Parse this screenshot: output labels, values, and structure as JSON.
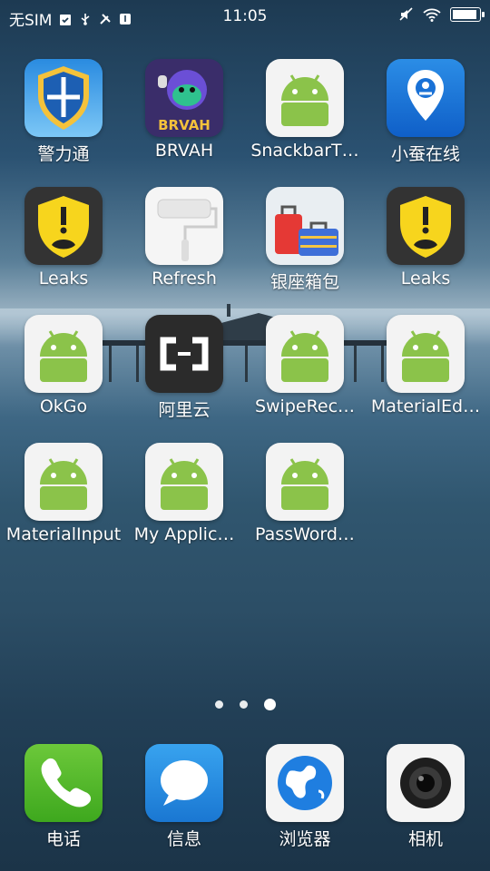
{
  "status": {
    "carrier": "无SIM",
    "time": "11:05"
  },
  "pages": {
    "count": 3,
    "current": 3
  },
  "apps": [
    {
      "label": "警力通",
      "icon": "shield-plane-icon"
    },
    {
      "label": "BRVAH",
      "icon": "gorilla-icon"
    },
    {
      "label": "SnackbarT…",
      "icon": "android-icon"
    },
    {
      "label": "小蚕在线",
      "icon": "pin-robot-icon"
    },
    {
      "label": "Leaks",
      "icon": "leak-shield-icon"
    },
    {
      "label": "Refresh",
      "icon": "paint-roller-icon"
    },
    {
      "label": "银座箱包",
      "icon": "luggage-icon"
    },
    {
      "label": "Leaks",
      "icon": "leak-shield-icon"
    },
    {
      "label": "OkGo",
      "icon": "android-icon"
    },
    {
      "label": "阿里云",
      "icon": "aliyun-icon"
    },
    {
      "label": "SwipeRec…",
      "icon": "android-icon"
    },
    {
      "label": "MaterialEd…",
      "icon": "android-icon"
    },
    {
      "label": "MaterialInput",
      "icon": "android-icon"
    },
    {
      "label": "My Applic…",
      "icon": "android-icon"
    },
    {
      "label": "PassWord…",
      "icon": "android-icon"
    }
  ],
  "dock": [
    {
      "label": "电话",
      "icon": "phone-icon"
    },
    {
      "label": "信息",
      "icon": "message-icon"
    },
    {
      "label": "浏览器",
      "icon": "browser-globe-icon"
    },
    {
      "label": "相机",
      "icon": "camera-icon"
    }
  ]
}
